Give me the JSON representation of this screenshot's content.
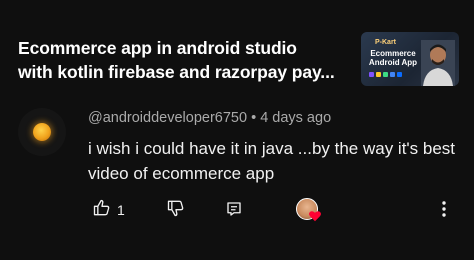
{
  "video": {
    "title_line1": "Ecommerce app in android studio",
    "title_line2": "with kotlin firebase and razorpay pay...",
    "thumbnail": {
      "brand": "P-Kart",
      "title": "Ecommerce Android App"
    }
  },
  "comment": {
    "author": "@androiddeveloper6750",
    "separator": " • ",
    "time": "4 days ago",
    "text": "i wish i could have it in java ...by the way it's best video of ecommerce app",
    "like_count": "1",
    "creator_hearted": true
  },
  "icons": {
    "like": "thumbs-up-icon",
    "dislike": "thumbs-down-icon",
    "reply": "reply-comment-icon",
    "heart": "heart-icon",
    "more": "more-vertical-icon"
  },
  "colors": {
    "background": "#0f0f0f",
    "text_primary": "#f1f1f1",
    "text_secondary": "#aaaaaa",
    "heart": "#ff0033"
  }
}
